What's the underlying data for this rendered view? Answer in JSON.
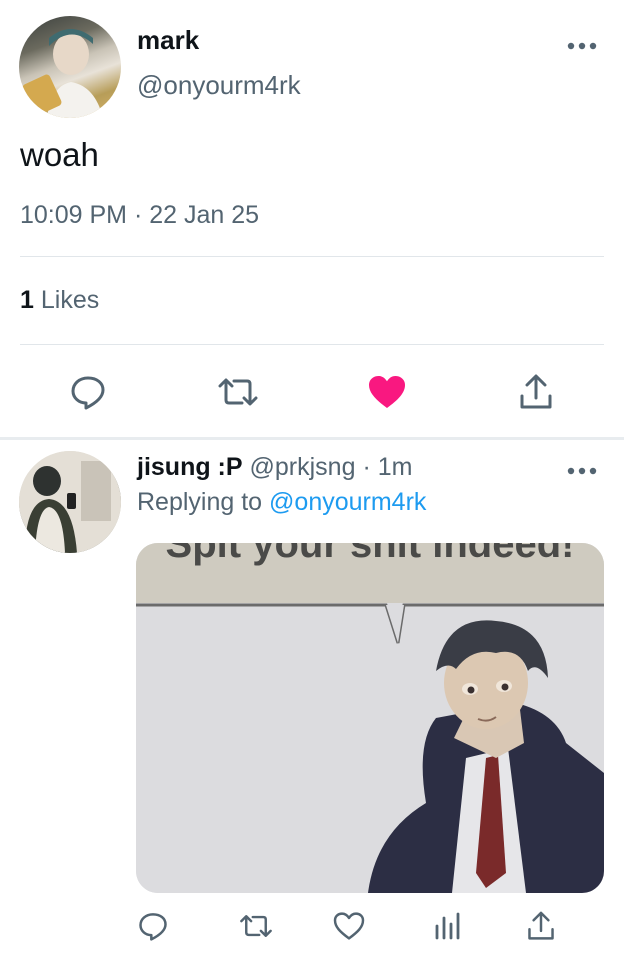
{
  "tweet": {
    "display_name": "mark",
    "handle": "@onyourm4rk",
    "text": "woah",
    "timestamp": "10:09 PM · 22 Jan 25",
    "likes_count": "1",
    "likes_label": "Likes",
    "liked": true,
    "like_color": "#f91880"
  },
  "reply": {
    "display_name": "jisung :P",
    "handle": "@prkjsng",
    "separator": "·",
    "time": "1m",
    "replying_prefix": "Replying to",
    "replying_to": "@onyourm4rk",
    "media_caption": "Spit your shit indeed!"
  },
  "icons": {
    "more": "more-horizontal-icon",
    "reply": "reply-icon",
    "retweet": "retweet-icon",
    "like": "heart-icon",
    "share": "share-icon",
    "views": "views-icon"
  },
  "colors": {
    "link": "#1d9bf0",
    "muted": "#536471",
    "divider": "#e1e6ea"
  }
}
